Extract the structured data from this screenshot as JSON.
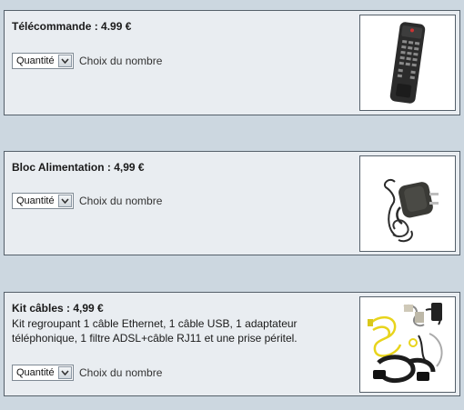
{
  "products": [
    {
      "title": "Télécommande : 4.99 €",
      "select_value": "Quantité",
      "select_hint": "Choix du nombre",
      "image": "remote-control-image"
    },
    {
      "title": "Bloc Alimentation : 4,99 €",
      "select_value": "Quantité",
      "select_hint": "Choix du nombre",
      "image": "power-adapter-image"
    },
    {
      "title": "Kit câbles : 4,99 €",
      "description": "Kit regroupant 1 câble Ethernet, 1 câble USB, 1 adaptateur téléphonique, 1 filtre ADSL+câble RJ11 et une prise péritel.",
      "select_value": "Quantité",
      "select_hint": "Choix du nombre",
      "image": "cable-kit-image"
    }
  ],
  "icons": {
    "dropdown": "chevron-down-icon"
  }
}
